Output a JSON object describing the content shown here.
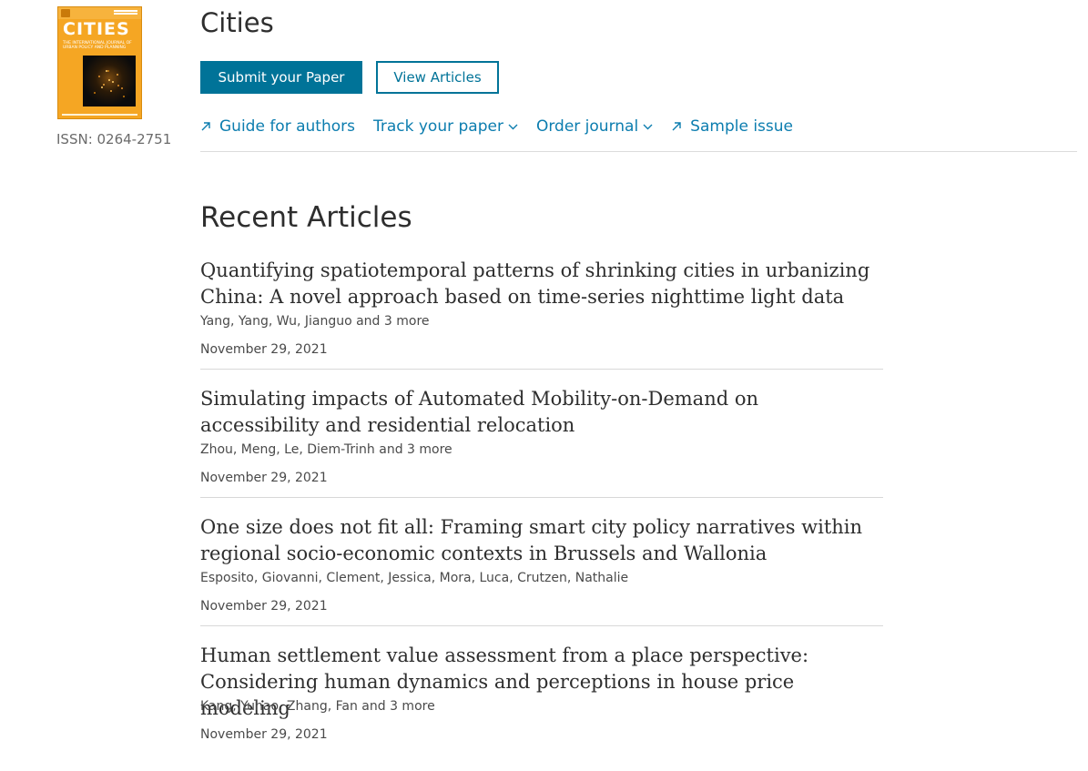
{
  "journal": {
    "title": "Cities",
    "cover_title": "CITIES",
    "cover_subtitle": "The International Journal of Urban Policy and Planning",
    "issn": "ISSN: 0264-2751"
  },
  "actions": {
    "submit_label": "Submit your Paper",
    "view_label": "View Articles"
  },
  "nav": {
    "items": [
      {
        "label": "Guide for authors",
        "icon": "external-link-icon"
      },
      {
        "label": "Track your paper",
        "icon": "chevron-down-icon"
      },
      {
        "label": "Order journal",
        "icon": "chevron-down-icon"
      },
      {
        "label": "Sample issue",
        "icon": "external-link-icon"
      }
    ]
  },
  "recent": {
    "heading": "Recent Articles",
    "articles": [
      {
        "title": "Quantifying spatiotemporal patterns of shrinking cities in urbanizing China: A novel approach based on time-series nighttime light data",
        "authors": "Yang, Yang, Wu, Jianguo and 3 more",
        "date": "November 29, 2021"
      },
      {
        "title": "Simulating impacts of Automated Mobility-on-Demand on accessibility and residential relocation",
        "authors": "Zhou, Meng, Le, Diem-Trinh and 3 more",
        "date": "November 29, 2021"
      },
      {
        "title": "One size does not fit all: Framing smart city policy narratives within regional socio-economic contexts in Brussels and Wallonia",
        "authors": "Esposito, Giovanni, Clement, Jessica, Mora, Luca, Crutzen, Nathalie",
        "date": "November 29, 2021"
      },
      {
        "title": "Human settlement value assessment from a place perspective: Considering human dynamics and perceptions in house price modeling",
        "authors": "Kang, Yuhao, Zhang, Fan and 3 more",
        "date": "November 29, 2021"
      }
    ]
  },
  "colors": {
    "accent": "#007398",
    "link": "#0c7daf",
    "cover": "#f5a623"
  }
}
